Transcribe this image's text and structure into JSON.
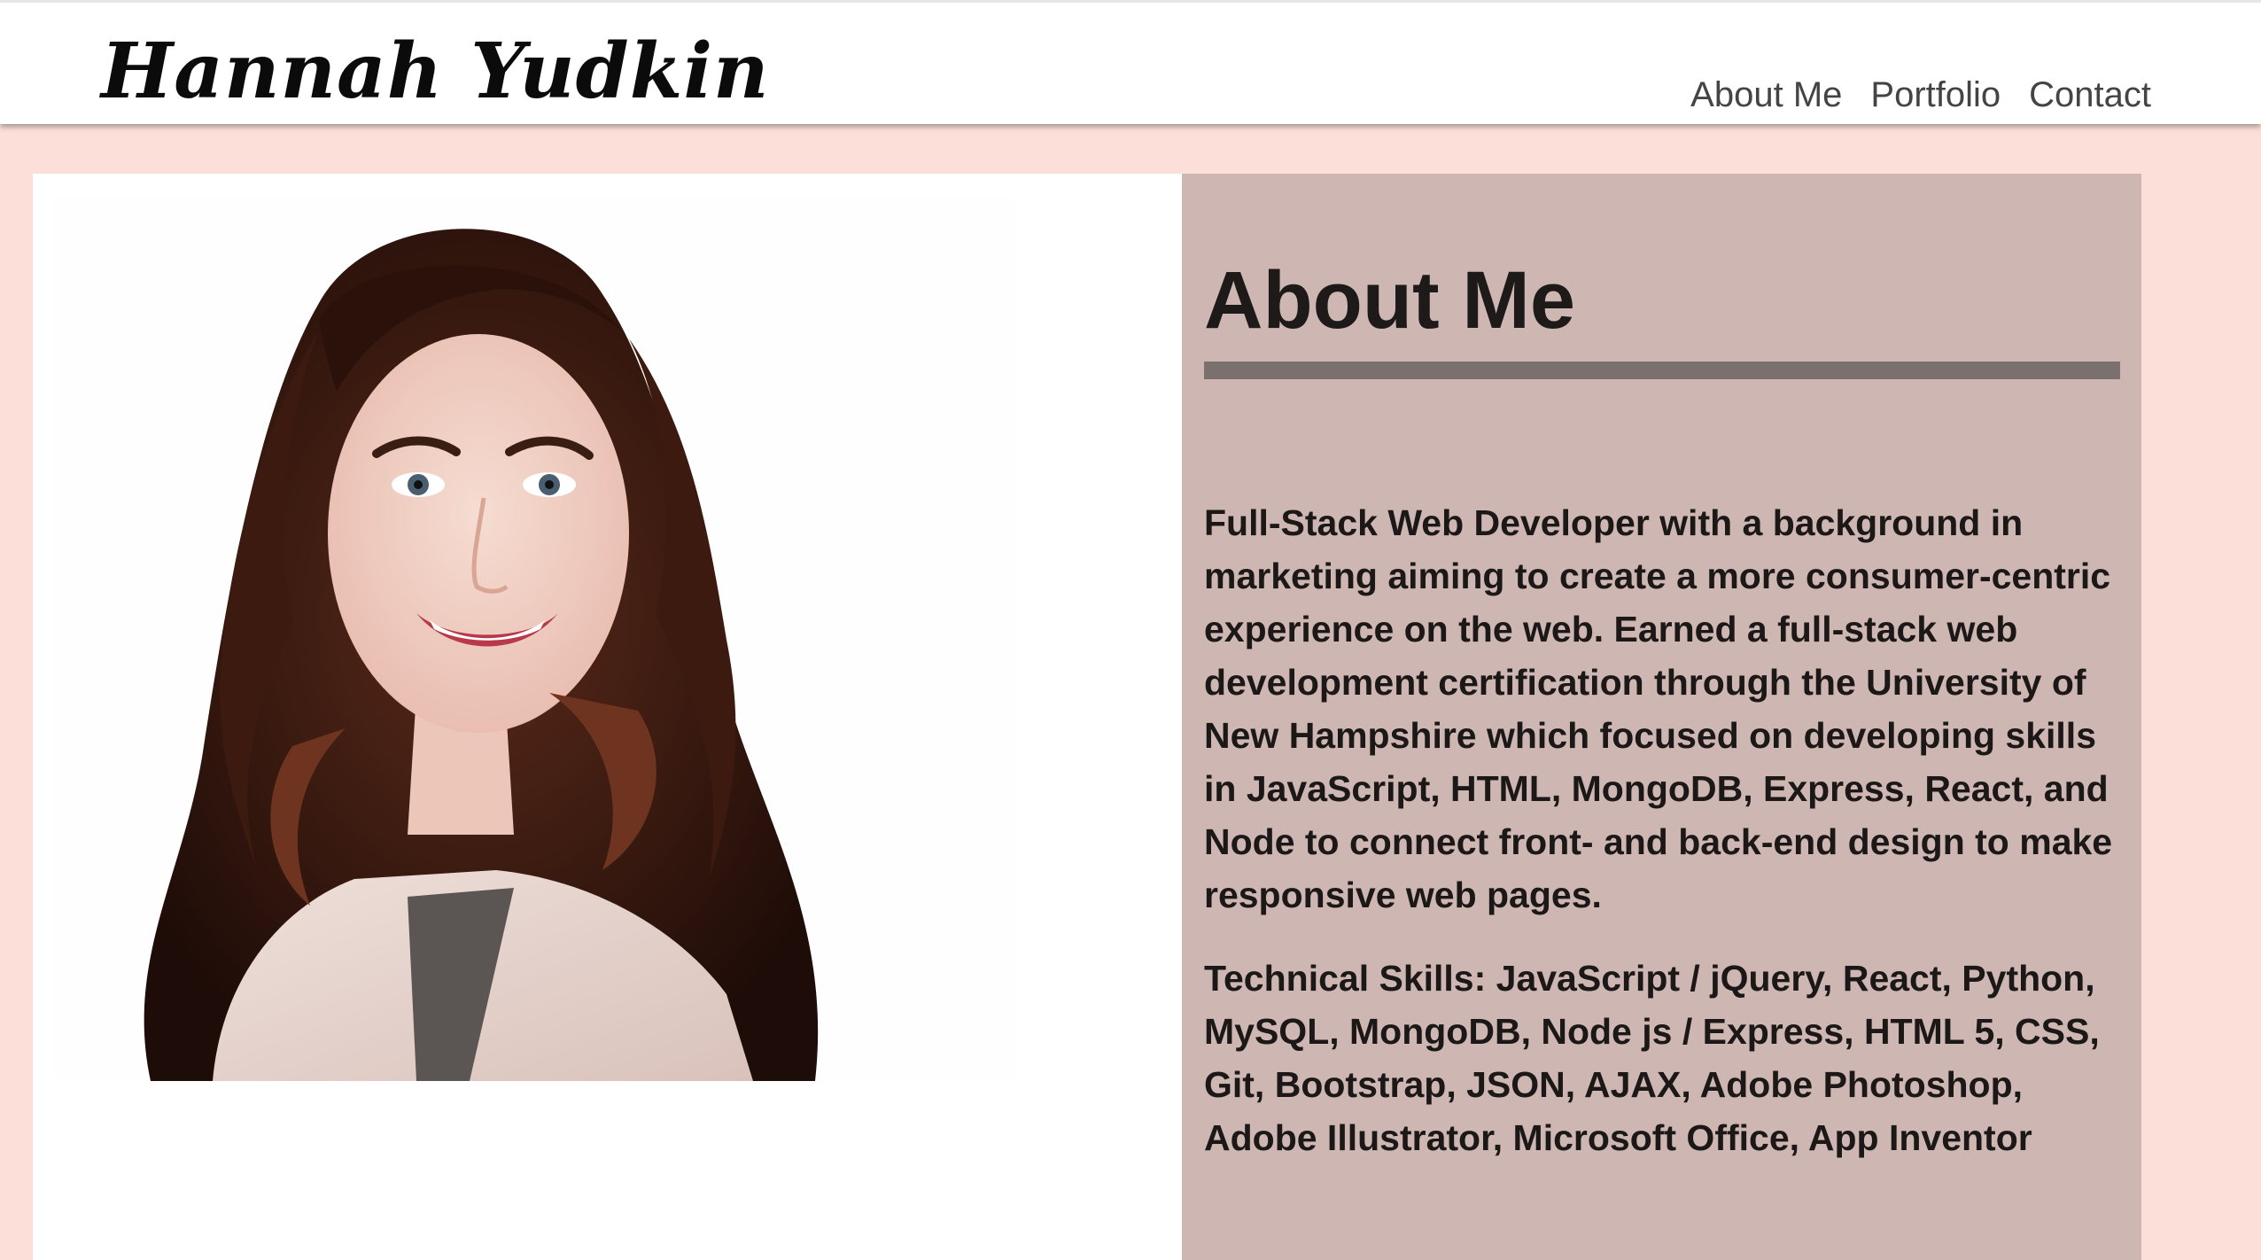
{
  "site": {
    "brand": "Hannah Yudkin"
  },
  "nav": {
    "items": [
      {
        "label": "About Me"
      },
      {
        "label": "Portfolio"
      },
      {
        "label": "Contact"
      }
    ]
  },
  "about": {
    "title": "About Me",
    "bio": "Full-Stack Web Developer with a background in marketing aiming to create a more consumer-centric experience on the web. Earned a full-stack web development certification through the University of New Hampshire which focused on developing skills in JavaScript, HTML, MongoDB, Express, React, and Node to connect front- and back-end design to make responsive web pages.",
    "skills": "Technical Skills: JavaScript / jQuery, React, Python, MySQL, MongoDB, Node js / Express, HTML 5, CSS, Git, Bootstrap, JSON, AJAX, Adobe Photoshop, Adobe Illustrator, Microsoft Office, App Inventor"
  },
  "colors": {
    "page_background": "#fbdfd8",
    "navbar_background": "#ffffff",
    "about_panel": "#ceb7b2",
    "about_rule": "#7a706e",
    "text_dark": "#1c1818",
    "nav_text": "#444444"
  }
}
